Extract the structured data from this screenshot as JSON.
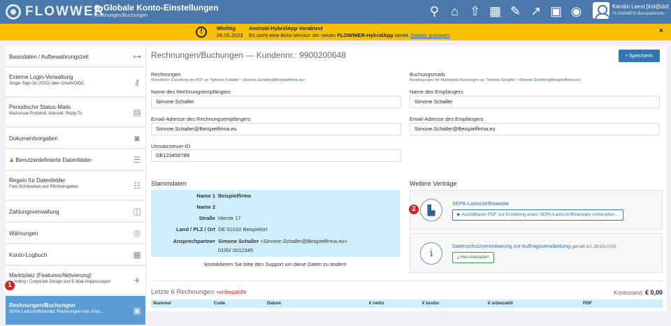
{
  "app": {
    "logo": "FLOWWER",
    "title": "Globale Konto-Einstellungen",
    "subtitle": "Rechnungen/Buchungen"
  },
  "toolbar_icons": [
    "search-icon",
    "home-icon",
    "upload-icon",
    "scan-icon",
    "edit-icon",
    "chart-icon",
    "image-icon",
    "camera-icon"
  ],
  "user": {
    "name": "Kerstin Leest [kol@dot",
    "company": "FLOWWER-Beispielkonto"
  },
  "banner": {
    "label1": "Wichtig",
    "label2": "26.05.2023",
    "title": "Android-HybridApp Vorabtest",
    "text_pre": "Es steht eine Beta-Version der neuen ",
    "text_bold": "FLOWWER-HybridApp",
    "text_post": " bereit. ",
    "link": "Details anzeigen",
    "close": "×"
  },
  "sidebar": {
    "items": [
      {
        "label": "Basisdaten / Aufbewahrungszeit",
        "sub": "",
        "icon": "sliders-icon"
      },
      {
        "label": "Externe Login-Verwaltung",
        "sub": "Single Sign-On (SSO) über OAuth/OIDC",
        "icon": "key-icon"
      },
      {
        "label": "Periodische Status-Mails",
        "sub": "Mail-in/out-Protokoll, Intervall, Reply-To",
        "icon": "mail-icon"
      },
      {
        "label": "Dokumentvorgaben",
        "sub": "",
        "icon": "camera-icon"
      },
      {
        "label": "Benutzerdefinierte Datenfelder",
        "sub": "",
        "icon": "list-icon"
      },
      {
        "label": "Regeln für Datenfelder",
        "sub": "Feld-Sichtbarkeit und Pflichteingaben",
        "icon": "checklist-icon"
      },
      {
        "label": "Zahlungsverwaltung",
        "sub": "",
        "icon": "money-icon"
      },
      {
        "label": "Währungen",
        "sub": "",
        "icon": "coins-icon"
      },
      {
        "label": "Konto-Logbuch",
        "sub": "",
        "icon": "book-icon"
      },
      {
        "label": "Marktplatz (Features/Aktivierung)",
        "sub": "Branding / Corporate Design und E-Mail-Anpassungen",
        "icon": "rocket-icon"
      },
      {
        "label": "Rechnungen/Buchungen",
        "sub": "SEPA-Lastschriftmandat, Rechnungen und -Emp...",
        "icon": "invoice-icon"
      }
    ],
    "badge": "1"
  },
  "main": {
    "title": "Rechnungen/Buchungen — Kundennr.: 9900200648",
    "save": "Speichern",
    "rechnungen": {
      "label": "Rechnungen",
      "sub_pre": "Monatliche Zustellung als PDF an ",
      "sub_green": "\"Simone Schaller\" <Simone.Schaller@Beispielfirma.eu>",
      "name_label": "Name des Rechnungsempfängers",
      "name_value": "Simone Schaller",
      "email_label": "Email-Adresse des Rechnungsempfängers",
      "email_value": "Simone.Schaller@Beispielfirma.eu",
      "ust_label": "Umsatzsteuer-ID",
      "ust_value": "DE123456789"
    },
    "buchungsmails": {
      "label": "Buchungsmails",
      "sub_pre": "Bestätigungen für Marktplatz-Buchungen an ",
      "sub_green": "\"Simone Schaller\" <Simone.Schaller@Beispielfirma.eu>",
      "name_label": "Name des Empfängers",
      "name_value": "Simone Schaller",
      "email_label": "Email-Adresse des Empfängers",
      "email_value": "Simone.Schaller@Beispielfirma.eu"
    },
    "stammdaten": {
      "title": "Stammdaten",
      "rows": [
        {
          "k": "Name 1",
          "v": "Beispielfirma",
          "bold": true
        },
        {
          "k": "Name 2",
          "v": ""
        },
        {
          "k": "Straße",
          "v": "Hierstr 17"
        },
        {
          "k": "Land / PLZ / Ort",
          "v": "DE 01010 Beispielort"
        },
        {
          "k": "Ansprechpartner",
          "v_bold": "Simone Schaller",
          "v_italic": "<Simone.Schaller@Beispielfirma.eu>",
          "v2": "0100/ 0012345"
        }
      ],
      "note": "kontaktieren Sie bitte den Support um diese Daten zu ändern"
    },
    "vertraege": {
      "title": "Weitere Verträge",
      "sepa_title": "SEPA-Lastschriftmandat",
      "sepa_button": "Ausfüllbares PDF zur Erstellung eines SEPA-Lastschriftmandats vorbereiten...",
      "ds_title": "Datenschutzvereinbarung zur Auftragsverarbeitung",
      "ds_suffix": "gemäß Art. 28 DS-GVO",
      "ds_button": "Herunterladen",
      "badge": "2"
    },
    "invoices": {
      "title": "Letzte 6 Rechnungen",
      "unpaid": "+unbezahlte",
      "balance_label": "Kontostand:",
      "balance_value": "€ 0,00",
      "columns": [
        "Nummer",
        "Code",
        "Datum",
        "€ netto",
        "€ brutto",
        "€ unbezahlt",
        "PDF"
      ]
    }
  }
}
